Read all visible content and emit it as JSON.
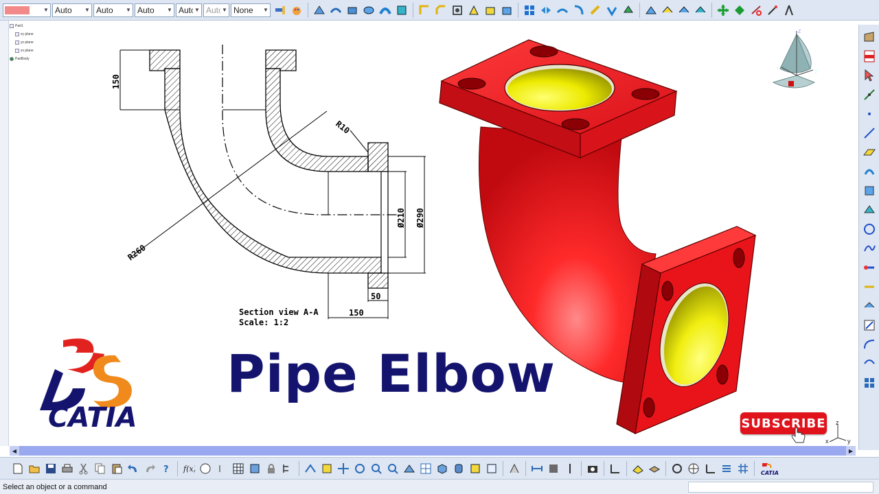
{
  "toolbar": {
    "color_swatch": "#f28a8a",
    "linetype_value": "Auto",
    "thickness_value": "Auto",
    "style_value": "Auto",
    "layer_value": "Autc",
    "render_value": "Autc",
    "layer_filter_value": "None"
  },
  "tree": {
    "root": "Part1",
    "xy": "xy plane",
    "yz": "yz plane",
    "zx": "zx plane",
    "body": "PartBody"
  },
  "drawing": {
    "dim_height": "150",
    "dim_r10": "R10",
    "dim_r260": "R260",
    "dim_d210": "Ø210",
    "dim_d290": "Ø290",
    "dim_50": "50",
    "dim_150_bottom": "150",
    "section_label": "Section view A-A",
    "scale_label": "Scale:  1:2"
  },
  "title": "Pipe Elbow",
  "logo": {
    "brand": "CATIA"
  },
  "subscribe": {
    "label": "SUBSCRIBE"
  },
  "compass": {
    "x": "x",
    "y": "y",
    "z": "z"
  },
  "axis": {
    "x": "x",
    "y": "y",
    "z": "z"
  },
  "status": {
    "message": "Select an object or a command"
  },
  "colors": {
    "model_red": "#e8141a",
    "model_yellow": "#f4f000",
    "title_navy": "#14146e",
    "logo_orange": "#f08a1c",
    "logo_red": "#e2221e",
    "scrollbar": "#9aa9ef"
  }
}
